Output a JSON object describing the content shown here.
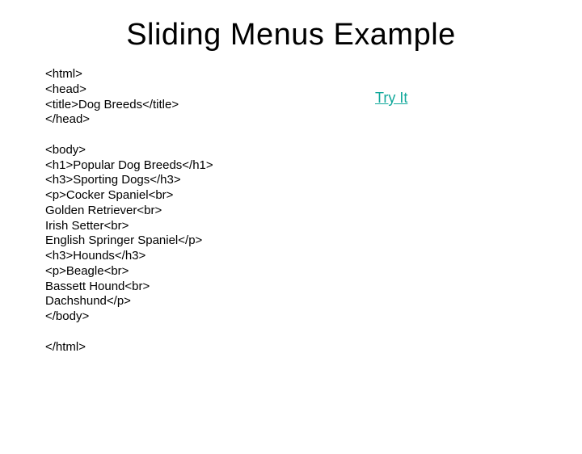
{
  "title": "Sliding Menus Example",
  "link": {
    "label": "Try It"
  },
  "code": "<html>\n<head>\n<title>Dog Breeds</title>\n</head>\n\n<body>\n<h1>Popular Dog Breeds</h1>\n<h3>Sporting Dogs</h3>\n<p>Cocker Spaniel<br>\nGolden Retriever<br>\nIrish Setter<br>\nEnglish Springer Spaniel</p>\n<h3>Hounds</h3>\n<p>Beagle<br>\nBassett Hound<br>\nDachshund</p>\n</body>\n\n</html>"
}
